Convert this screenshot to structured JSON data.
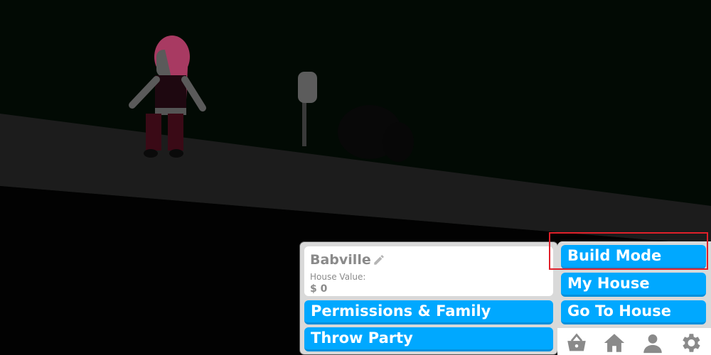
{
  "scene": {
    "description": "Roblox Bloxburg night scene: avatar with pink hair on sidewalk, mailbox, trash bag"
  },
  "house_panel": {
    "house_name": "Babville",
    "house_value_label": "House Value:",
    "house_value": "$ 0",
    "permissions_button": "Permissions & Family",
    "throw_party_button": "Throw Party"
  },
  "menu_panel": {
    "build_mode_button": "Build Mode",
    "my_house_button": "My House",
    "go_to_house_button": "Go To House"
  },
  "icon_bar": [
    {
      "icon": "shop-basket-icon"
    },
    {
      "icon": "home-icon"
    },
    {
      "icon": "profile-icon"
    },
    {
      "icon": "settings-gear-icon"
    }
  ],
  "colors": {
    "button_blue": "#00a8ff",
    "panel_gray": "#d9d9d9",
    "highlight_red": "#e0202a",
    "icon_gray": "#8a8a8a"
  }
}
